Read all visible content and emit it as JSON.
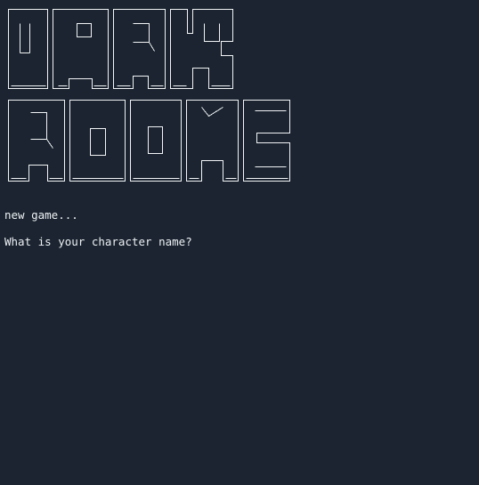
{
  "title_art": {
    "line1": "DARK",
    "line2": "ROOMS"
  },
  "terminal": {
    "lines": [
      "new game...",
      "What is your character name?"
    ],
    "input_value": ""
  },
  "colors": {
    "background": "#1b2430",
    "text": "#eef1f4"
  }
}
